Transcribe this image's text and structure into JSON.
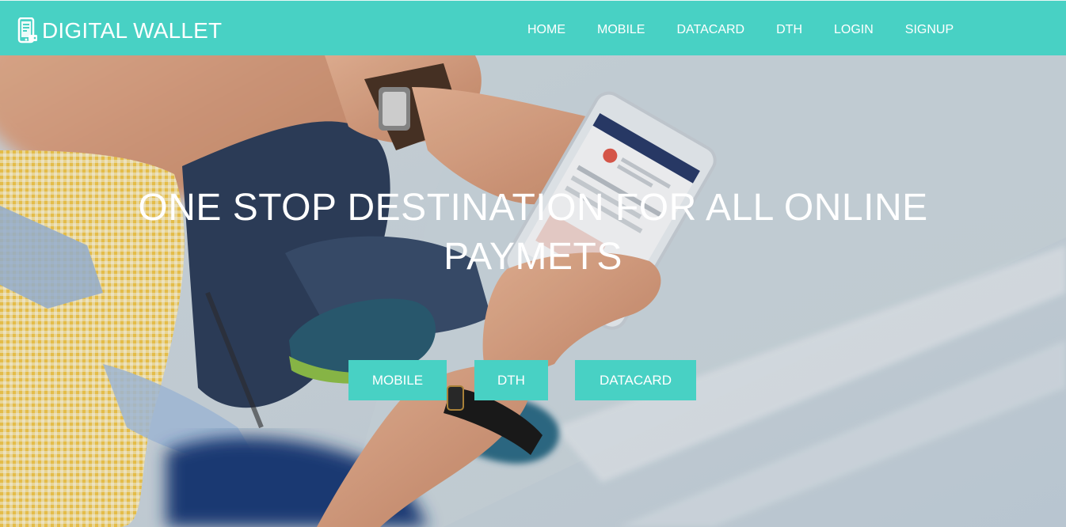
{
  "brand": {
    "name": "DIGITAL WALLET",
    "icon": "mobile-wallet-icon"
  },
  "nav": {
    "items": [
      {
        "label": "HOME"
      },
      {
        "label": "MOBILE"
      },
      {
        "label": "DATACARD"
      },
      {
        "label": "DTH"
      },
      {
        "label": "LOGIN"
      },
      {
        "label": "SIGNUP"
      }
    ]
  },
  "hero": {
    "title": "ONE STOP DESTINATION FOR ALL ONLINE PAYMETS",
    "buttons": {
      "mobile": "MOBILE",
      "dth": "DTH",
      "datacard": "DATACARD"
    },
    "image": "person-holding-smartphone-photo"
  },
  "colors": {
    "accent": "#48d1c4",
    "text": "#ffffff"
  }
}
